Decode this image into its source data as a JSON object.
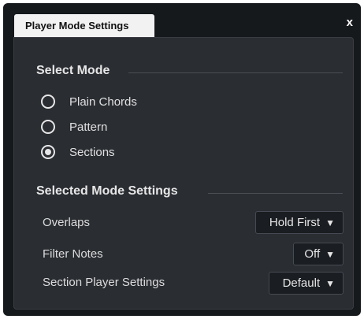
{
  "window": {
    "tab_title": "Player Mode Settings",
    "close_label": "x"
  },
  "select_mode": {
    "title": "Select Mode",
    "options": [
      {
        "label": "Plain Chords",
        "checked": false
      },
      {
        "label": "Pattern",
        "checked": false
      },
      {
        "label": "Sections",
        "checked": true
      }
    ]
  },
  "mode_settings": {
    "title": "Selected Mode Settings",
    "rows": [
      {
        "label": "Overlaps",
        "value": "Hold First"
      },
      {
        "label": "Filter Notes",
        "value": "Off"
      },
      {
        "label": "Section Player Settings",
        "value": "Default"
      }
    ]
  },
  "icons": {
    "dropdown_arrow": "triangle-down-icon",
    "close": "close-icon"
  }
}
